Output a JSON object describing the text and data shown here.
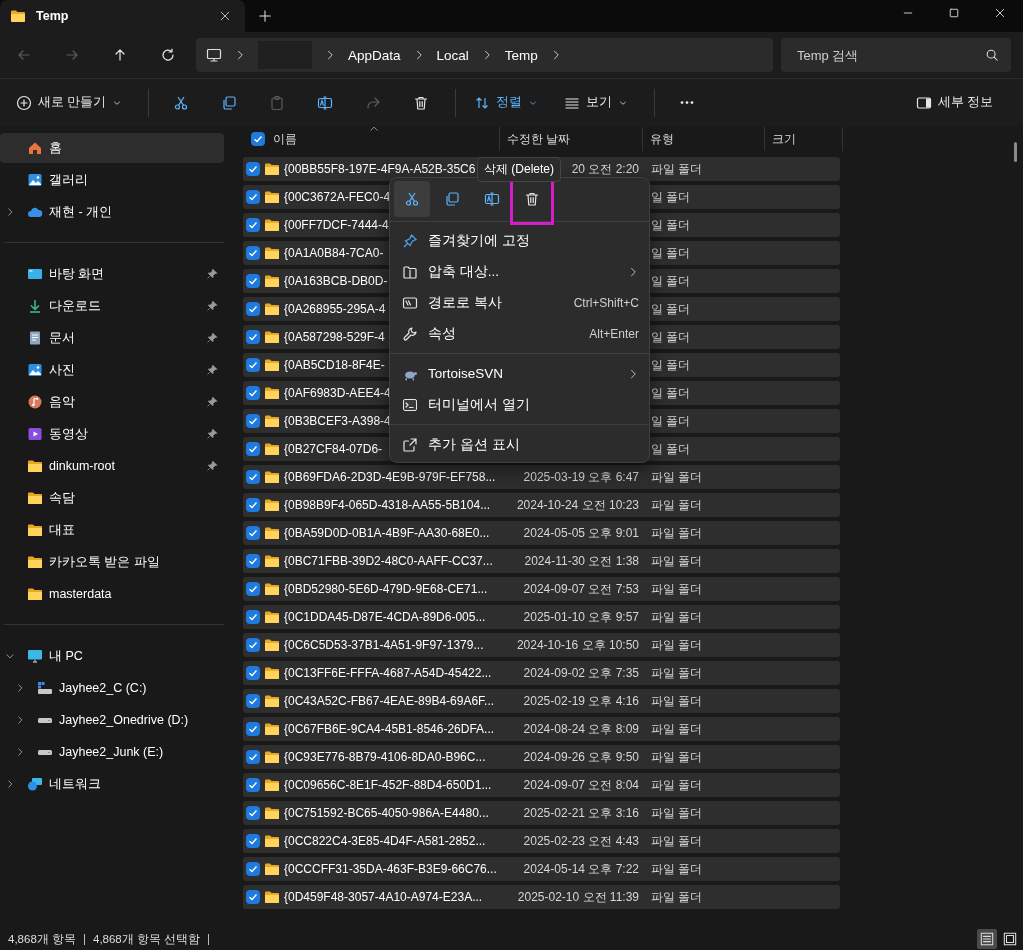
{
  "window": {
    "tab_title": "Temp"
  },
  "nav": [
    {
      "kind": "back",
      "disabled": true
    },
    {
      "kind": "forward",
      "disabled": true
    },
    {
      "kind": "up",
      "disabled": false
    },
    {
      "kind": "refresh",
      "disabled": false
    }
  ],
  "breadcrumb": [
    {
      "kind": "redacted"
    },
    {
      "kind": "folder",
      "label": "AppData"
    },
    {
      "kind": "folder",
      "label": "Local"
    },
    {
      "kind": "folder",
      "label": "Temp"
    }
  ],
  "search": {
    "placeholder": "Temp 검색"
  },
  "toolbar": [
    {
      "kind": "new",
      "label": "새로 만들기",
      "disabled": false
    },
    {
      "kind": "separator"
    },
    {
      "kind": "cut",
      "disabled": false
    },
    {
      "kind": "copy",
      "disabled": false
    },
    {
      "kind": "paste",
      "disabled": true
    },
    {
      "kind": "rename",
      "disabled": false
    },
    {
      "kind": "share",
      "disabled": true
    },
    {
      "kind": "delete",
      "disabled": false
    },
    {
      "kind": "separator"
    },
    {
      "kind": "sort",
      "label": "정렬",
      "disabled": false
    },
    {
      "kind": "view",
      "label": "보기",
      "disabled": false
    },
    {
      "kind": "separator"
    },
    {
      "kind": "more",
      "disabled": false
    }
  ],
  "details_button": {
    "label": "세부 정보"
  },
  "sidebar": {
    "sections": [
      [
        {
          "label": "홈",
          "kind": "home",
          "selected": true,
          "pinned": false
        },
        {
          "label": "갤러리",
          "kind": "gallery",
          "selected": false,
          "pinned": false
        },
        {
          "label": "재현 - 개인",
          "kind": "cloud",
          "selected": false,
          "pinned": false,
          "expanded": false
        }
      ],
      [
        {
          "label": "바탕 화면",
          "kind": "desktop",
          "selected": false,
          "pinned": true
        },
        {
          "label": "다운로드",
          "kind": "download",
          "selected": false,
          "pinned": true
        },
        {
          "label": "문서",
          "kind": "document",
          "selected": false,
          "pinned": true
        },
        {
          "label": "사진",
          "kind": "photo",
          "selected": false,
          "pinned": true
        },
        {
          "label": "음악",
          "kind": "music",
          "selected": false,
          "pinned": true
        },
        {
          "label": "동영상",
          "kind": "video",
          "selected": false,
          "pinned": true
        },
        {
          "label": "dinkum-root",
          "kind": "folder",
          "selected": false,
          "pinned": true
        },
        {
          "label": "속담",
          "kind": "folder",
          "selected": false,
          "pinned": false
        },
        {
          "label": "대표",
          "kind": "folder",
          "selected": false,
          "pinned": false
        },
        {
          "label": "카카오톡 받은 파일",
          "kind": "folder",
          "selected": false,
          "pinned": false
        },
        {
          "label": "masterdata",
          "kind": "folder",
          "selected": false,
          "pinned": false
        }
      ],
      [
        {
          "label": "내 PC",
          "kind": "pc",
          "selected": false,
          "pinned": false,
          "expanded": true,
          "children": [
            {
              "label": "Jayhee2_C (C:)",
              "kind": "sysdrive",
              "selected": false,
              "pinned": false,
              "expanded": false
            },
            {
              "label": "Jayhee2_Onedrive (D:)",
              "kind": "drive",
              "selected": false,
              "pinned": false,
              "expanded": false
            },
            {
              "label": "Jayhee2_Junk (E:)",
              "kind": "drive",
              "selected": false,
              "pinned": false,
              "expanded": false
            }
          ]
        },
        {
          "label": "네트워크",
          "kind": "network",
          "selected": false,
          "pinned": false,
          "expanded": false
        }
      ]
    ]
  },
  "table": {
    "all_checked": true,
    "columns": [
      {
        "label": "이름",
        "sorted": true
      },
      {
        "label": "수정한 날짜",
        "sorted": false
      },
      {
        "label": "유형",
        "sorted": false
      },
      {
        "label": "크기",
        "sorted": false
      }
    ],
    "rows": [
      {
        "name": "{00BB55F8-197E-4F9A-A52B-35C6",
        "date": "20 오전 2:20",
        "type": "파일 폴더",
        "checked": true
      },
      {
        "name": "{00C3672A-FEC0-4",
        "type": "일 폴더",
        "checked": true
      },
      {
        "name": "{00FF7DCF-7444-4",
        "type": "일 폴더",
        "checked": true
      },
      {
        "name": "{0A1A0B84-7CA0-",
        "type": "일 폴더",
        "checked": true
      },
      {
        "name": "{0A163BCB-DB0D-",
        "type": "일 폴더",
        "checked": true
      },
      {
        "name": "{0A268955-295A-4",
        "type": "일 폴더",
        "checked": true
      },
      {
        "name": "{0A587298-529F-4",
        "type": "일 폴더",
        "checked": true
      },
      {
        "name": "{0AB5CD18-8F4E-",
        "type": "일 폴더",
        "checked": true
      },
      {
        "name": "{0AF6983D-AEE4-4",
        "type": "일 폴더",
        "checked": true
      },
      {
        "name": "{0B3BCEF3-A398-4",
        "type": "일 폴더",
        "checked": true
      },
      {
        "name": "{0B27CF84-07D6-",
        "type": "일 폴더",
        "checked": true
      },
      {
        "name": "{0B69FDA6-2D3D-4E9B-979F-EF758...",
        "date": "2025-03-19 오후 6:47",
        "type": "파일 폴더",
        "checked": true
      },
      {
        "name": "{0B98B9F4-065D-4318-AA55-5B104...",
        "date": "2024-10-24 오전 10:23",
        "type": "파일 폴더",
        "checked": true
      },
      {
        "name": "{0BA59D0D-0B1A-4B9F-AA30-68E0...",
        "date": "2024-05-05 오후 9:01",
        "type": "파일 폴더",
        "checked": true
      },
      {
        "name": "{0BC71FBB-39D2-48C0-AAFF-CC37...",
        "date": "2024-11-30 오전 1:38",
        "type": "파일 폴더",
        "checked": true
      },
      {
        "name": "{0BD52980-5E6D-479D-9E68-CE71...",
        "date": "2024-09-07 오전 7:53",
        "type": "파일 폴더",
        "checked": true
      },
      {
        "name": "{0C1DDA45-D87E-4CDA-89D6-005...",
        "date": "2025-01-10 오후 9:57",
        "type": "파일 폴더",
        "checked": true
      },
      {
        "name": "{0C6C5D53-37B1-4A51-9F97-1379...",
        "date": "2024-10-16 오후 10:50",
        "type": "파일 폴더",
        "checked": true
      },
      {
        "name": "{0C13FF6E-FFFA-4687-A54D-45422...",
        "date": "2024-09-02 오후 7:35",
        "type": "파일 폴더",
        "checked": true
      },
      {
        "name": "{0C43A52C-FB67-4EAE-89B4-69A6F...",
        "date": "2025-02-19 오후 4:16",
        "type": "파일 폴더",
        "checked": true
      },
      {
        "name": "{0C67FB6E-9CA4-45B1-8546-26DFA...",
        "date": "2024-08-24 오후 8:09",
        "type": "파일 폴더",
        "checked": true
      },
      {
        "name": "{0C93E776-8B79-4106-8DA0-B96C...",
        "date": "2024-09-26 오후 9:50",
        "type": "파일 폴더",
        "checked": true
      },
      {
        "name": "{0C09656C-8E1F-452F-88D4-650D1...",
        "date": "2024-09-07 오전 8:04",
        "type": "파일 폴더",
        "checked": true
      },
      {
        "name": "{0C751592-BC65-4050-986A-E4480...",
        "date": "2025-02-21 오후 3:16",
        "type": "파일 폴더",
        "checked": true
      },
      {
        "name": "{0CC822C4-3E85-4D4F-A581-2852...",
        "date": "2025-02-23 오전 4:43",
        "type": "파일 폴더",
        "checked": true
      },
      {
        "name": "{0CCCFF31-35DA-463F-B3E9-66C76...",
        "date": "2024-05-14 오후 7:22",
        "type": "파일 폴더",
        "checked": true
      },
      {
        "name": "{0D459F48-3057-4A10-A974-E23A...",
        "date": "2025-02-10 오전 11:39",
        "type": "파일 폴더",
        "checked": true
      }
    ]
  },
  "context_menu": {
    "tooltip": "삭제 (Delete)",
    "actions": [
      {
        "kind": "cut",
        "hovered": true,
        "highlighted": false
      },
      {
        "kind": "copy",
        "hovered": false,
        "highlighted": false
      },
      {
        "kind": "rename",
        "hovered": false,
        "highlighted": false
      },
      {
        "kind": "delete",
        "hovered": false,
        "highlighted": true
      }
    ],
    "items": [
      {
        "kind": "pin",
        "label": "즐겨찾기에 고정",
        "submenu": false
      },
      {
        "kind": "zip",
        "label": "압축 대상...",
        "submenu": true
      },
      {
        "kind": "copypath",
        "label": "경로로 복사",
        "shortcut": "Ctrl+Shift+C",
        "submenu": false
      },
      {
        "kind": "props",
        "label": "속성",
        "shortcut": "Alt+Enter",
        "submenu": false
      },
      {
        "kind": "separator"
      },
      {
        "kind": "svn",
        "label": "TortoiseSVN",
        "submenu": true
      },
      {
        "kind": "terminal",
        "label": "터미널에서 열기",
        "submenu": false
      },
      {
        "kind": "separator"
      },
      {
        "kind": "moreopts",
        "label": "추가 옵션 표시",
        "submenu": false
      }
    ]
  },
  "status_bar": {
    "item_count": "4,868개 항목",
    "selection": "4,868개 항목 선택함",
    "views": [
      {
        "kind": "details",
        "selected": true
      },
      {
        "kind": "tiles",
        "selected": false
      }
    ]
  }
}
